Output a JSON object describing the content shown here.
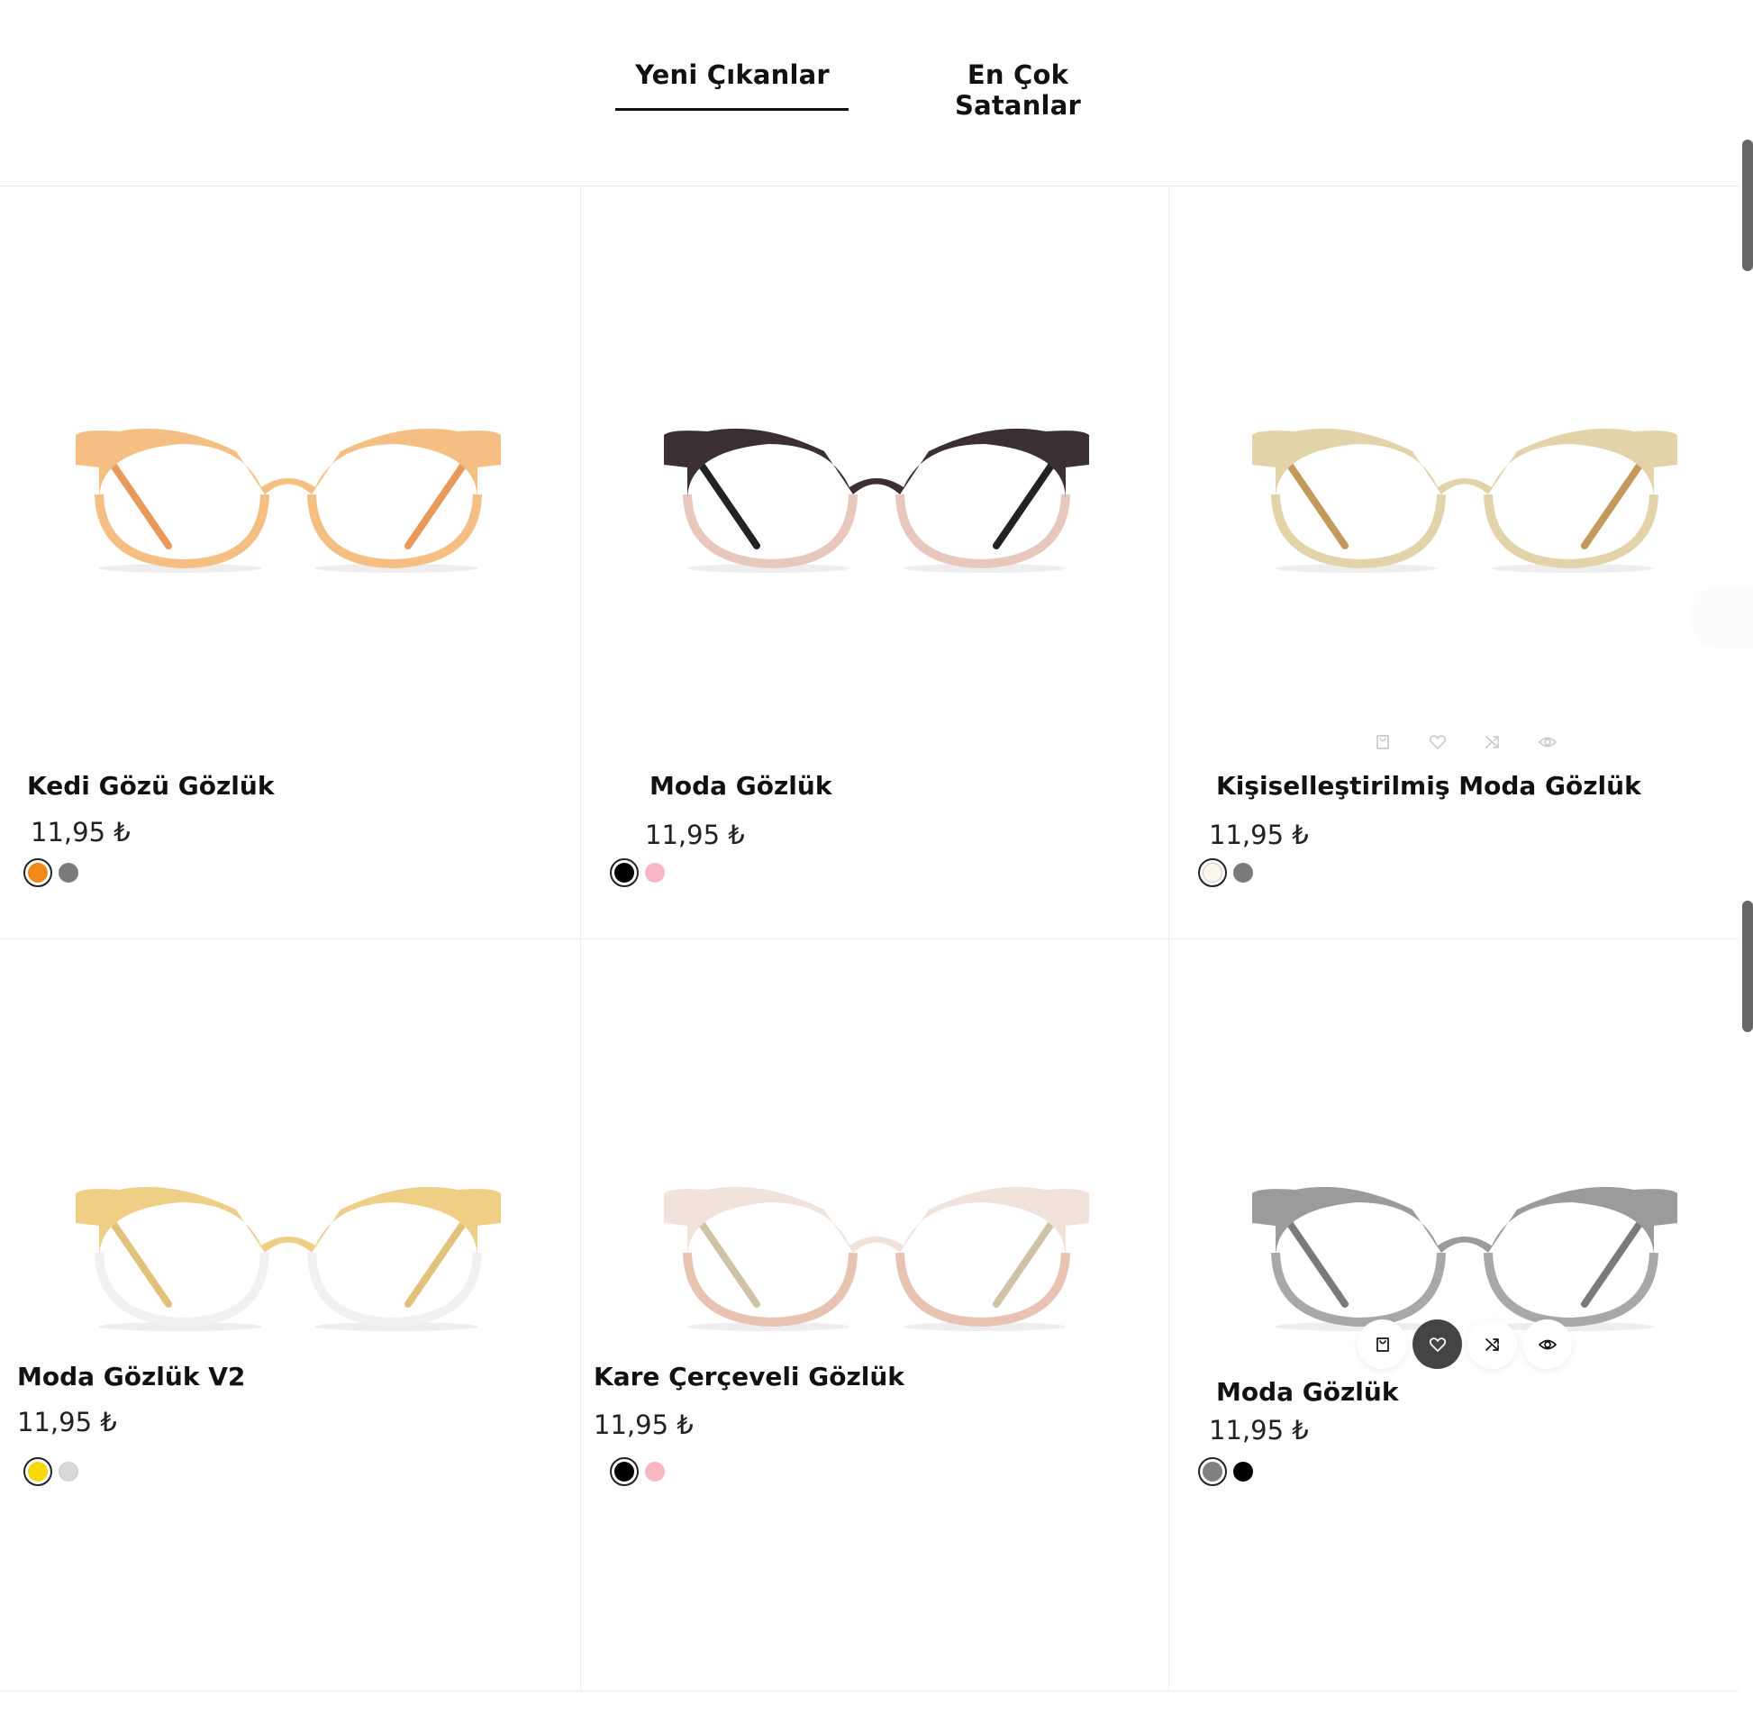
{
  "tabs": [
    {
      "label": "Yeni Çıkanlar",
      "active": true
    },
    {
      "label": "En Çok Satanlar",
      "active": false
    }
  ],
  "products": [
    {
      "name": "Kedi Gözü Gözlük",
      "price": "11,95 ₺",
      "colors": [
        "#f08a17",
        "#7a7a7a"
      ],
      "selected": 0,
      "image_icon": "cat-eye-glasses-image",
      "frame": "#f5bf83",
      "frame_bottom": "#f5bf83",
      "temple": "#e89a5a"
    },
    {
      "name": "Moda Gözlük",
      "price": "11,95 ₺",
      "colors": [
        "#000000",
        "#f7b8c4"
      ],
      "selected": 0,
      "image_icon": "browline-glasses-image",
      "frame": "#3a2f31",
      "frame_bottom": "#e8c7bd",
      "temple": "#222222"
    },
    {
      "name": "Kişiselleştirilmiş Moda Gözlük",
      "price": "11,95 ₺",
      "colors": [
        "#fbf7ea",
        "#7a7a7a"
      ],
      "selected": 0,
      "image_icon": "round-glasses-image",
      "frame": "#e3d3a8",
      "frame_bottom": "#e3d3a8",
      "temple": "#c49a5c"
    },
    {
      "name": "Moda Gözlük V2",
      "price": "11,95 ₺",
      "colors": [
        "#f5d90a",
        "#d9d9d9"
      ],
      "selected": 0,
      "image_icon": "two-tone-glasses-image",
      "frame": "#efcf86",
      "frame_bottom": "#f1f1f1",
      "temple": "#e1c27a"
    },
    {
      "name": "Kare Çerçeveli Gözlük",
      "price": "11,95 ₺",
      "colors": [
        "#000000",
        "#f7b8c4"
      ],
      "selected": 0,
      "image_icon": "clear-browline-glasses-image",
      "frame": "#f1e2dc",
      "frame_bottom": "#e9c3b2",
      "temple": "#cfc3a6"
    },
    {
      "name": "Moda Gözlük",
      "price": "11,95 ₺",
      "colors": [
        "#808080",
        "#000000"
      ],
      "selected": 0,
      "image_icon": "grey-cat-eye-glasses-image",
      "frame": "#9a9b9b",
      "frame_bottom": "#a8a8a8",
      "temple": "#7a7a7a"
    }
  ],
  "actions": [
    "cart-icon",
    "heart-icon",
    "shuffle-icon",
    "eye-icon"
  ]
}
